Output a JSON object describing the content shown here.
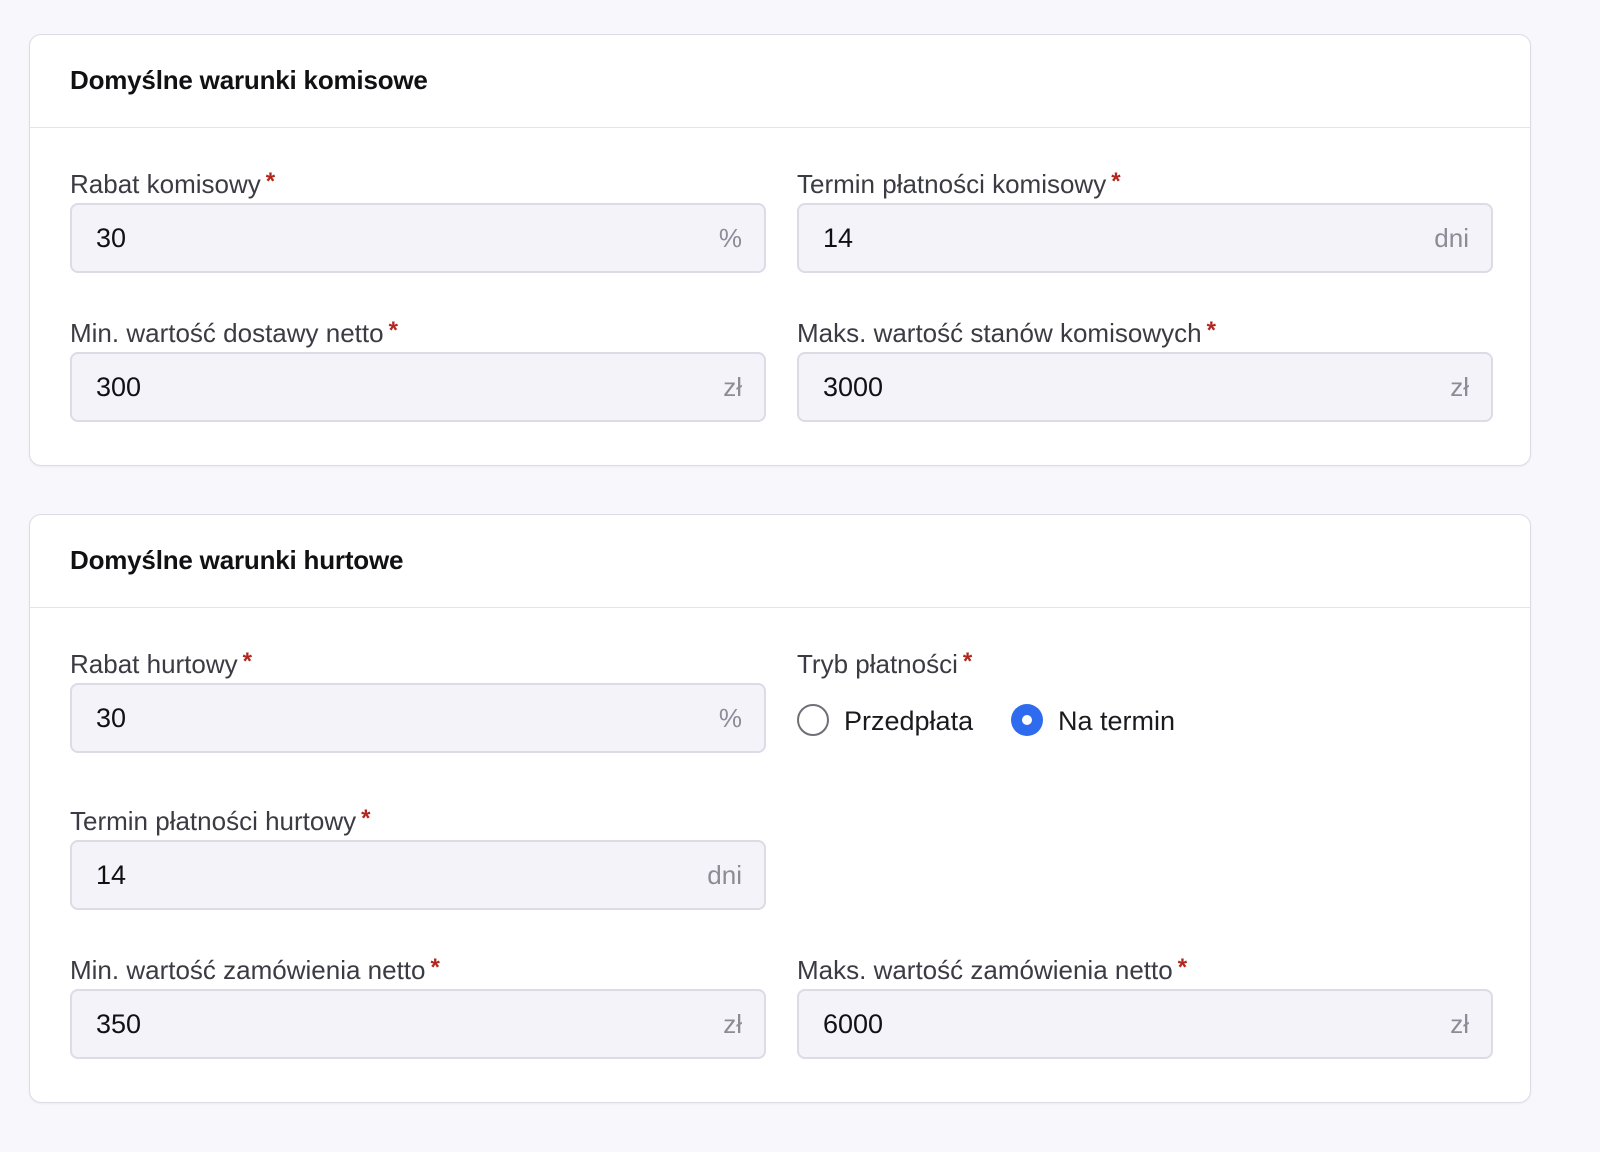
{
  "consignment": {
    "title": "Domyślne warunki komisowe",
    "required_mark": "*",
    "fields": [
      {
        "label": "Rabat komisowy",
        "value": "30",
        "suffix": "%"
      },
      {
        "label": "Termin płatności komisowy",
        "value": "14",
        "suffix": "dni"
      },
      {
        "label": "Min. wartość dostawy netto",
        "value": "300",
        "suffix": "zł"
      },
      {
        "label": "Maks. wartość stanów komisowych",
        "value": "3000",
        "suffix": "zł"
      }
    ]
  },
  "wholesale": {
    "title": "Domyślne warunki hurtowe",
    "fields": [
      {
        "label": "Rabat hurtowy",
        "value": "30",
        "suffix": "%"
      },
      {
        "label": "Termin płatności hurtowy",
        "value": "14",
        "suffix": "dni"
      },
      {
        "label": "Min. wartość zamówienia netto",
        "value": "350",
        "suffix": "zł"
      },
      {
        "label": "Maks. wartość zamówienia netto",
        "value": "6000",
        "suffix": "zł"
      }
    ],
    "payment_mode": {
      "label": "Tryb płatności",
      "options": [
        {
          "label": "Przedpłata",
          "checked": false
        },
        {
          "label": "Na termin",
          "checked": true
        }
      ]
    }
  },
  "colors": {
    "accent": "#2f6bef",
    "required": "#b3261e",
    "page_background": "#f8f7fc"
  }
}
